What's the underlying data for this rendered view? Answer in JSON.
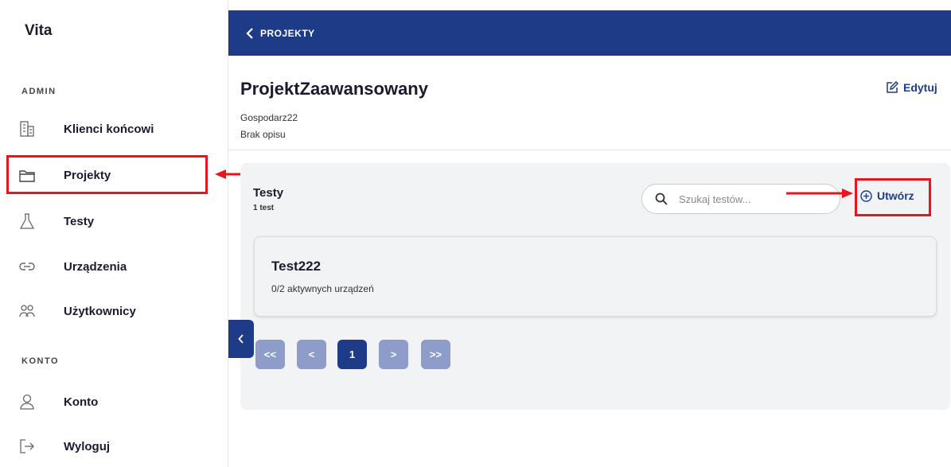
{
  "sidebar": {
    "brand": "Vita",
    "admin_label": "ADMIN",
    "account_label": "KONTO",
    "items": [
      {
        "label": "Klienci końcowi",
        "icon": "building-icon"
      },
      {
        "label": "Projekty",
        "icon": "folder-icon"
      },
      {
        "label": "Testy",
        "icon": "flask-icon"
      },
      {
        "label": "Urządzenia",
        "icon": "link-icon"
      },
      {
        "label": "Użytkownicy",
        "icon": "users-icon"
      },
      {
        "label": "Konto",
        "icon": "user-icon"
      },
      {
        "label": "Wyloguj",
        "icon": "logout-icon"
      }
    ]
  },
  "topbar": {
    "back_label": "PROJEKTY"
  },
  "project": {
    "title": "ProjektZaawansowany",
    "edit_label": "Edytuj",
    "owner": "Gospodarz22",
    "description": "Brak opisu"
  },
  "tests": {
    "title": "Testy",
    "count": "1 test",
    "search_placeholder": "Szukaj testów...",
    "create_label": "Utwórz",
    "items": [
      {
        "name": "Test222",
        "devices": "0/2 aktywnych urządzeń"
      }
    ]
  },
  "pagination": {
    "first": "<<",
    "prev": "<",
    "current": "1",
    "next": ">",
    "last": ">>"
  },
  "colors": {
    "primary": "#1d3b87",
    "annotation": "#e8151d",
    "page_inactive": "#8d9cc9"
  }
}
